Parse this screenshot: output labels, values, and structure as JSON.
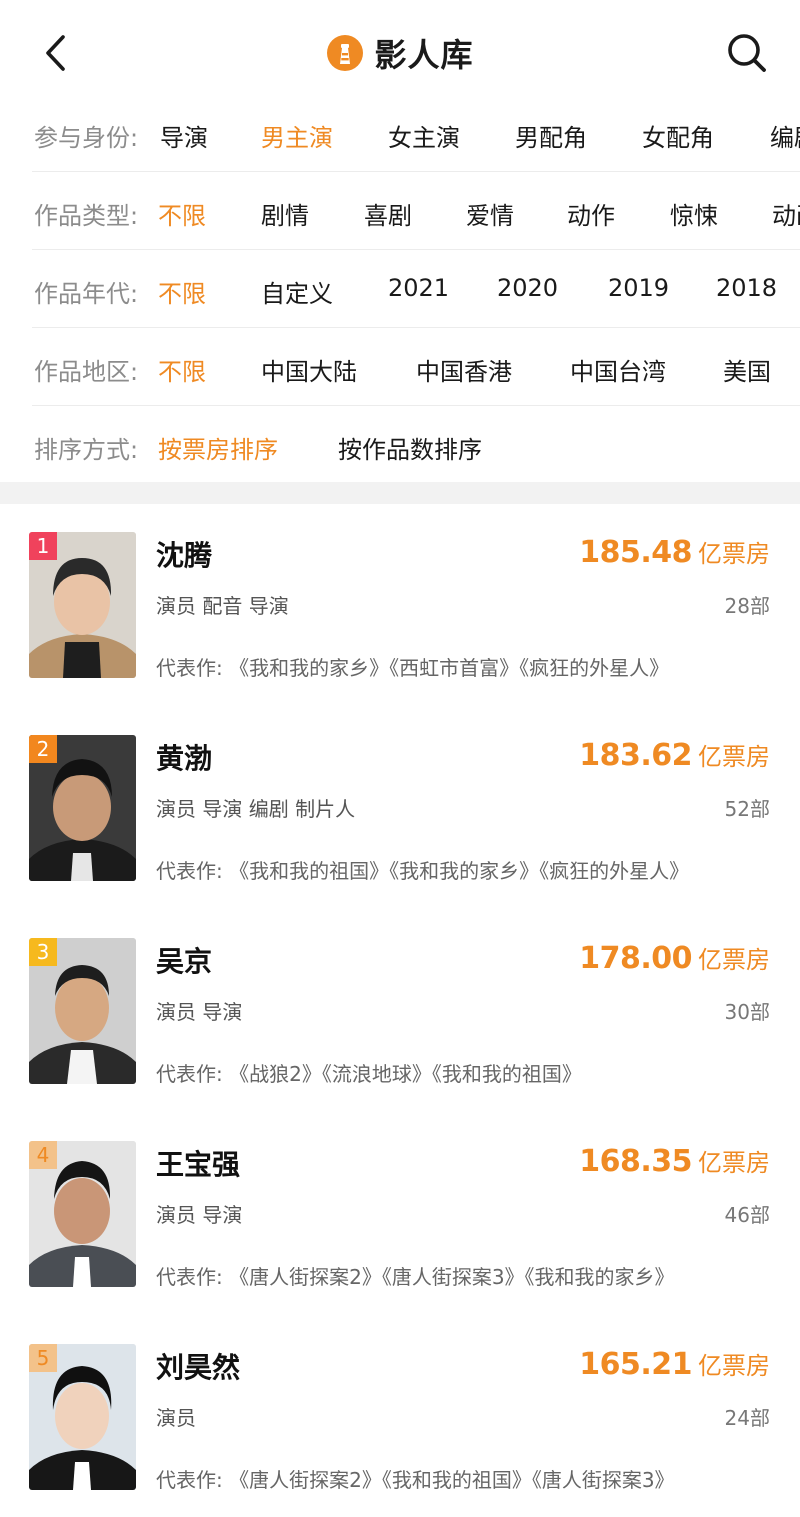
{
  "header": {
    "title": "影人库",
    "back_icon": "chevron-left-icon",
    "logo_icon": "lighthouse-logo",
    "search_icon": "search-icon"
  },
  "colors": {
    "accent": "#ef8a23",
    "rank1": "#f0425c",
    "rank2": "#f2871e",
    "rank3": "#f6b91e",
    "rank_other": "#f3c28a"
  },
  "filters": {
    "role": {
      "label": "参与身份:",
      "options": [
        "导演",
        "男主演",
        "女主演",
        "男配角",
        "女配角",
        "编剧"
      ],
      "selected": "男主演"
    },
    "genre": {
      "label": "作品类型:",
      "options": [
        "不限",
        "剧情",
        "喜剧",
        "爱情",
        "动作",
        "惊悚",
        "动画"
      ],
      "selected": "不限"
    },
    "era": {
      "label": "作品年代:",
      "options": [
        "不限",
        "自定义",
        "2021",
        "2020",
        "2019",
        "2018"
      ],
      "selected": "不限"
    },
    "region": {
      "label": "作品地区:",
      "options": [
        "不限",
        "中国大陆",
        "中国香港",
        "中国台湾",
        "美国"
      ],
      "selected": "不限"
    },
    "sort": {
      "label": "排序方式:",
      "options": [
        "按票房排序",
        "按作品数排序"
      ],
      "selected": "按票房排序"
    }
  },
  "list": [
    {
      "rank": "1",
      "name": "沈腾",
      "roles": "演员 配音 导演",
      "box_office": "185.48",
      "unit": "亿票房",
      "works_count": "28部",
      "works_label": "代表作:",
      "works": "《我和我的家乡》《西虹市首富》《疯狂的外星人》"
    },
    {
      "rank": "2",
      "name": "黄渤",
      "roles": "演员 导演 编剧 制片人",
      "box_office": "183.62",
      "unit": "亿票房",
      "works_count": "52部",
      "works_label": "代表作:",
      "works": "《我和我的祖国》《我和我的家乡》《疯狂的外星人》"
    },
    {
      "rank": "3",
      "name": "吴京",
      "roles": "演员 导演",
      "box_office": "178.00",
      "unit": "亿票房",
      "works_count": "30部",
      "works_label": "代表作:",
      "works": "《战狼2》《流浪地球》《我和我的祖国》"
    },
    {
      "rank": "4",
      "name": "王宝强",
      "roles": "演员 导演",
      "box_office": "168.35",
      "unit": "亿票房",
      "works_count": "46部",
      "works_label": "代表作:",
      "works": "《唐人街探案2》《唐人街探案3》《我和我的家乡》"
    },
    {
      "rank": "5",
      "name": "刘昊然",
      "roles": "演员",
      "box_office": "165.21",
      "unit": "亿票房",
      "works_count": "24部",
      "works_label": "代表作:",
      "works": "《唐人街探案2》《我和我的祖国》《唐人街探案3》"
    }
  ]
}
